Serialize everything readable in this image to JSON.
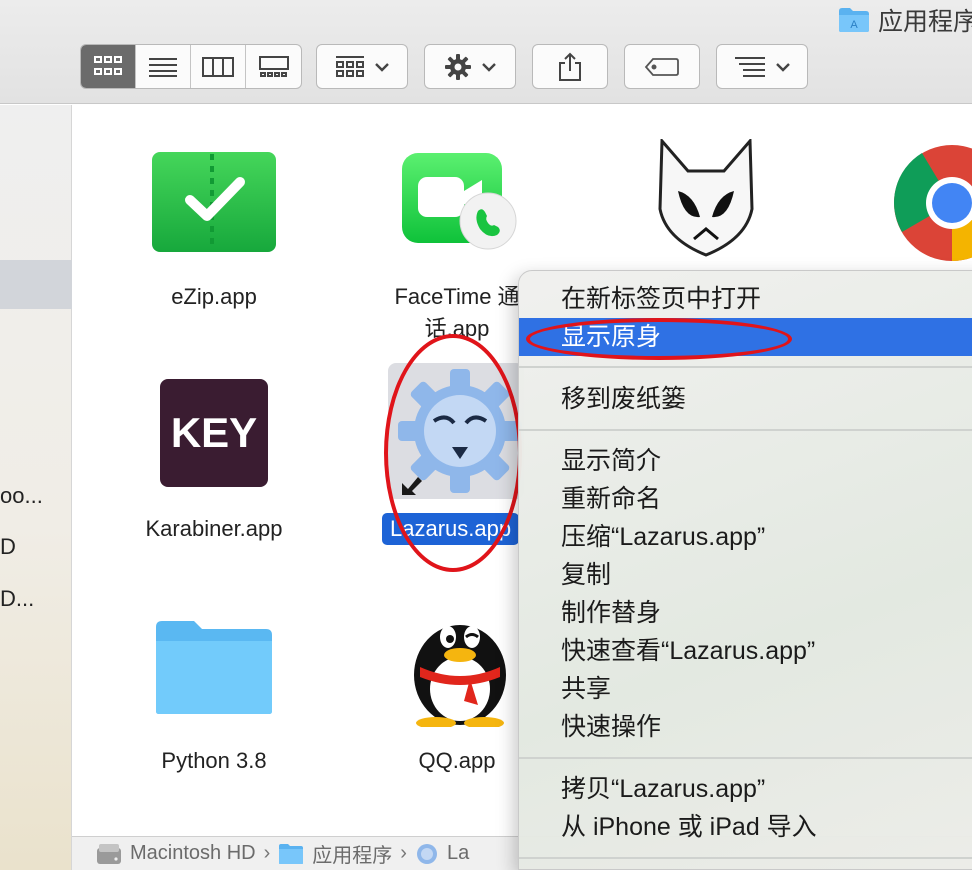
{
  "window": {
    "title": "应用程序"
  },
  "toolbar": {
    "view_modes": [
      "icon-view",
      "list-view",
      "column-view",
      "gallery-view"
    ],
    "active_view": "icon-view",
    "buttons": [
      "group-by",
      "action-gear",
      "share",
      "tags",
      "sort-by"
    ]
  },
  "sidebar": {
    "items": [
      "oo...",
      "D",
      "D..."
    ]
  },
  "files": [
    {
      "name": "eZip.app",
      "icon": "ezip-icon"
    },
    {
      "name": "FaceTime 通话.app",
      "line1": "FaceTime 通",
      "line2": "话.app",
      "icon": "facetime-icon"
    },
    {
      "name": "",
      "icon": "foobar-fox-icon"
    },
    {
      "name": "",
      "icon": "chrome-icon"
    },
    {
      "name": "Karabiner.app",
      "icon": "keynote-icon"
    },
    {
      "name": "Lazarus.app",
      "icon": "lazarus-icon",
      "selected": true
    },
    {
      "name": "Python 3.8",
      "icon": "folder-icon"
    },
    {
      "name": "QQ.app",
      "icon": "qq-penguin-icon"
    }
  ],
  "context_menu": {
    "items": [
      {
        "label": "在新标签页中打开"
      },
      {
        "label": "显示原身",
        "highlighted": true
      },
      {
        "label": "移到废纸篓"
      },
      {
        "label": "显示简介"
      },
      {
        "label": "重新命名"
      },
      {
        "label": "压缩“Lazarus.app”"
      },
      {
        "label": "复制"
      },
      {
        "label": "制作替身"
      },
      {
        "label": "快速查看“Lazarus.app”"
      },
      {
        "label": "共享"
      },
      {
        "label": "快速操作"
      },
      {
        "label": "拷贝“Lazarus.app”"
      },
      {
        "label": "从 iPhone 或 iPad 导入"
      }
    ]
  },
  "pathbar": {
    "segments": [
      "Macintosh HD",
      "应用程序",
      "La"
    ]
  },
  "colors": {
    "highlight": "#2f71e4",
    "selection": "#1d63d6",
    "annotation": "#e0141a"
  }
}
